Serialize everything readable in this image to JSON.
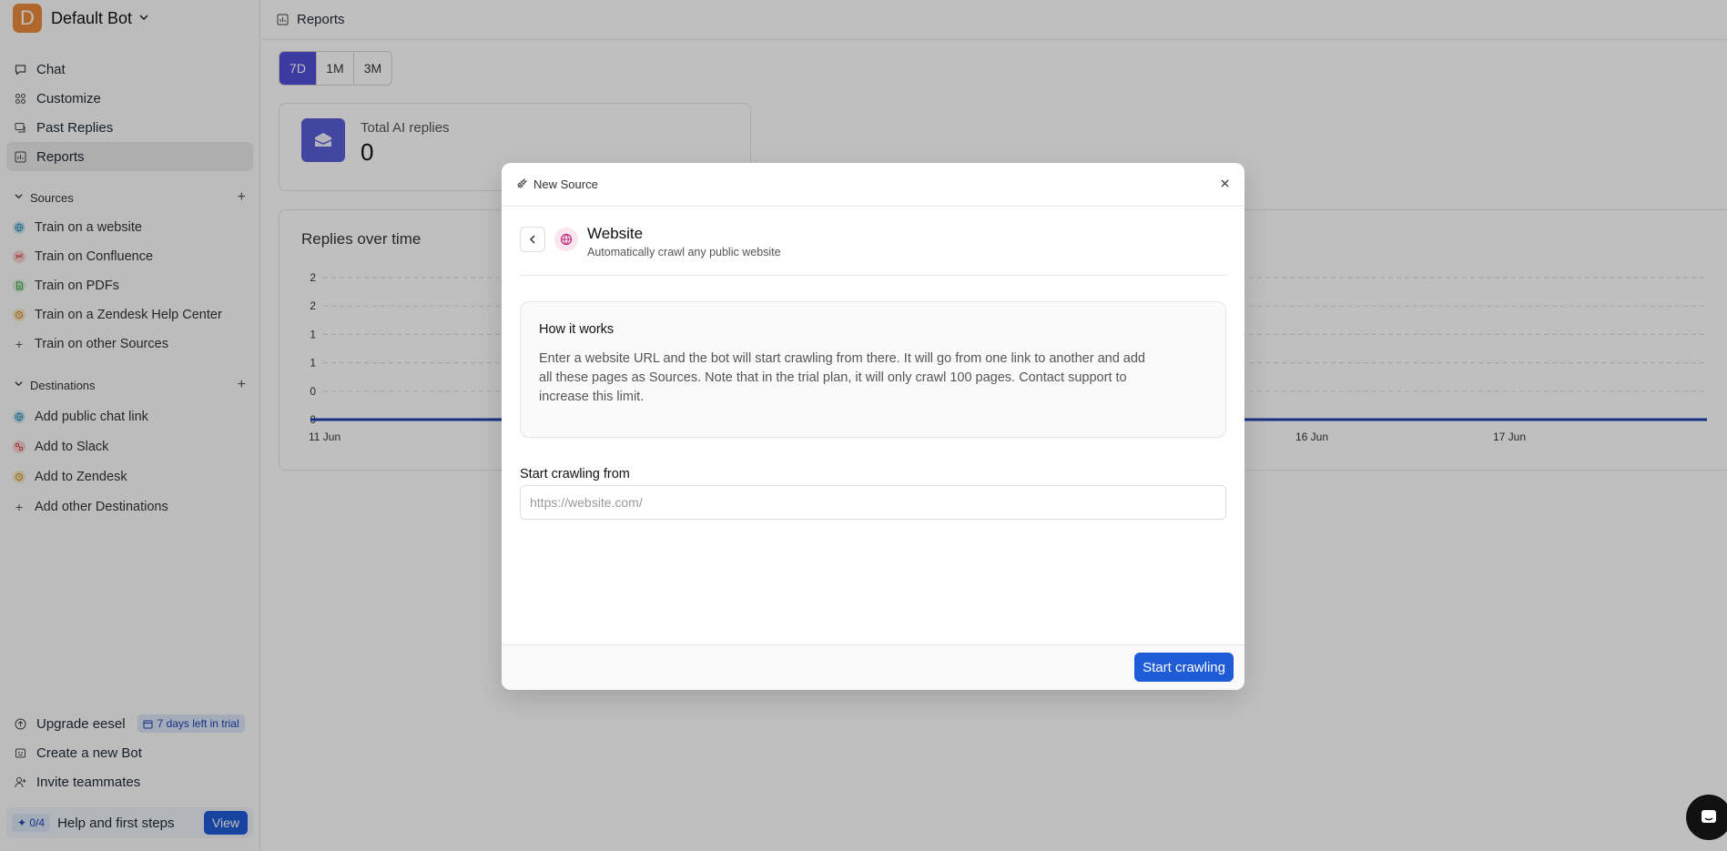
{
  "sidebar": {
    "bot_initial": "D",
    "bot_name": "Default Bot",
    "nav": [
      {
        "label": "Chat",
        "icon": "chat-bubble-icon"
      },
      {
        "label": "Customize",
        "icon": "grid-icon"
      },
      {
        "label": "Past Replies",
        "icon": "messages-icon"
      },
      {
        "label": "Reports",
        "icon": "chart-icon"
      }
    ],
    "sources_title": "Sources",
    "sources": [
      {
        "label": "Train on a website",
        "icon": "globe-icon",
        "color": "#5aa9c9"
      },
      {
        "label": "Train on Confluence",
        "icon": "confluence-icon",
        "color": "#d9534f"
      },
      {
        "label": "Train on PDFs",
        "icon": "pdf-icon",
        "color": "#4caf50"
      },
      {
        "label": "Train on a Zendesk Help Center",
        "icon": "zendesk-icon",
        "color": "#e0a030"
      },
      {
        "label": "Train on other Sources",
        "icon": "plus-icon",
        "color": ""
      }
    ],
    "destinations_title": "Destinations",
    "destinations": [
      {
        "label": "Add public chat link",
        "icon": "globe-icon",
        "color": "#5aa9c9"
      },
      {
        "label": "Add to Slack",
        "icon": "slack-icon",
        "color": "#d9534f"
      },
      {
        "label": "Add to Zendesk",
        "icon": "zendesk-icon",
        "color": "#e0a030"
      },
      {
        "label": "Add other Destinations",
        "icon": "plus-icon",
        "color": ""
      }
    ],
    "footer": {
      "upgrade": "Upgrade eesel",
      "trial_badge": "7 days left in trial",
      "create_bot": "Create a new Bot",
      "invite": "Invite teammates",
      "help_progress": "0/4",
      "help_label": "Help and first steps",
      "view_label": "View"
    }
  },
  "topbar": {
    "title": "Reports"
  },
  "ranges": [
    "7D",
    "1M",
    "3M"
  ],
  "active_range": "7D",
  "stat": {
    "label": "Total AI replies",
    "value": "0"
  },
  "chart_data": {
    "type": "line",
    "title": "Replies over time",
    "y_ticks": [
      "2",
      "2",
      "1",
      "1",
      "0",
      "0"
    ],
    "x_ticks": [
      "11 Jun",
      "16 Jun",
      "17 Jun"
    ],
    "series": [
      {
        "values": [
          0,
          0,
          0,
          0,
          0,
          0,
          0
        ]
      }
    ],
    "line_color": "#1e40af"
  },
  "modal": {
    "header": "New Source",
    "source_title": "Website",
    "source_subtitle": "Automatically crawl any public website",
    "how_title": "How it works",
    "how_text": "Enter a website URL and the bot will start crawling from there. It will go from one link to another and add all these pages as Sources. Note that in the trial plan, it will only crawl 100 pages. Contact support to increase this limit.",
    "field_label": "Start crawling from",
    "field_placeholder": "https://website.com/",
    "submit_label": "Start crawling"
  },
  "colors": {
    "accent": "#1e5bd6",
    "range_active": "#4f4fd8",
    "bot_avatar": "#ea8a3a"
  }
}
